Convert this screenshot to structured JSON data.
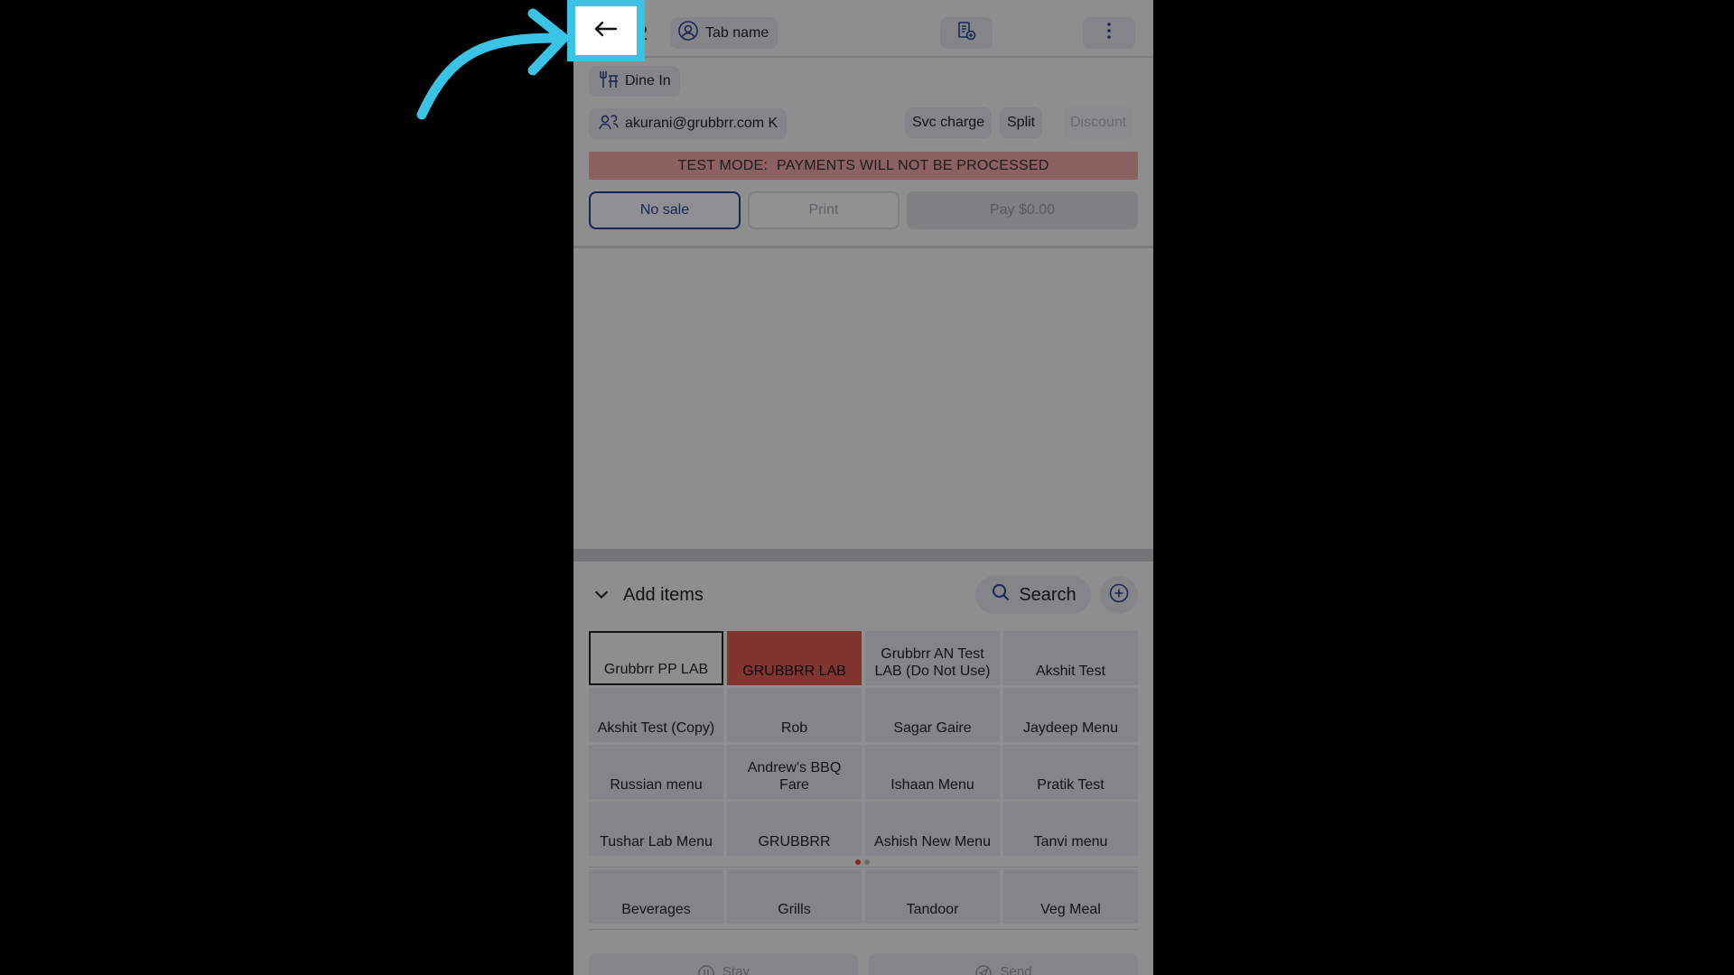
{
  "header": {
    "order_number_fragment": "2",
    "tab_name_label": "Tab name"
  },
  "order": {
    "dine_in_label": "Dine In",
    "customer_label": "akurani@grubbrr.com K",
    "svc_charge_label": "Svc charge",
    "split_label": "Split",
    "discount_label": "Discount"
  },
  "banner": {
    "prefix": "TEST MODE:",
    "message": "PAYMENTS WILL NOT BE PROCESSED"
  },
  "actions": {
    "no_sale_label": "No sale",
    "print_label": "Print",
    "pay_label": "Pay $0.00"
  },
  "items_panel": {
    "title": "Add items",
    "search_label": "Search",
    "menus": [
      "Grubbrr PP LAB",
      "GRUBBRR LAB",
      "Grubbrr AN Test LAB (Do Not Use)",
      "Akshit Test",
      "Akshit Test (Copy)",
      "Rob",
      "Sagar Gaire",
      "Jaydeep Menu",
      "Russian menu",
      "Andrew's BBQ Fare",
      "Ishaan Menu",
      "Pratik Test",
      "Tushar Lab Menu",
      "GRUBBRR",
      "Ashish New Menu",
      "Tanvi menu"
    ],
    "categories": [
      "Beverages",
      "Grills",
      "Tandoor",
      "Veg Meal"
    ]
  },
  "footer": {
    "stay_label": "Stay",
    "send_label": "Send"
  },
  "colors": {
    "highlight": "#3bc3e6",
    "selected_menu": "#e05a52",
    "primary": "#2b3f8f",
    "test_banner": "#f2a8a8"
  },
  "icons": {
    "back": "arrow-left-icon",
    "tab_name": "user-circle-icon",
    "order_options": "receipt-icon",
    "more": "vertical-dots-icon",
    "dine_in": "dining-icon",
    "customer": "users-icon",
    "collapse": "chevron-down-icon",
    "search": "search-icon",
    "add": "plus-circle-icon",
    "stay": "stay-icon",
    "send": "send-icon",
    "annotation": "curved-arrow"
  }
}
